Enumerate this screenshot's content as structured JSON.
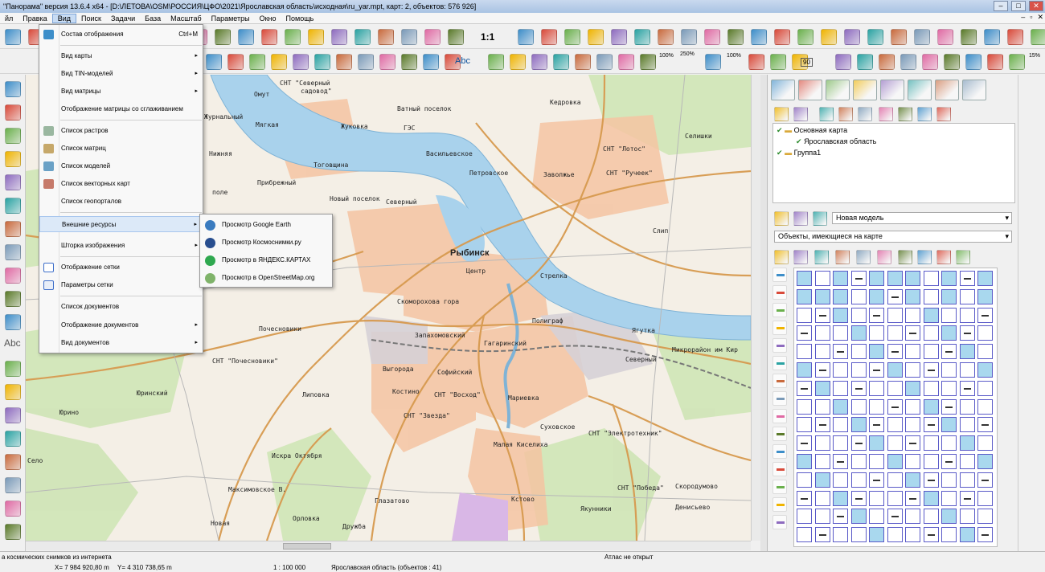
{
  "window": {
    "title": "\"Панорама\" версия 13.6.4 x64 - [D:\\ЛЕТОВА\\OSM\\РОССИЯ\\ЦФО\\2021\\Ярославская область\\исходная\\ru_yar.mpt, карт: 2, объектов: 576 926]",
    "btn_min": "–",
    "btn_max": "□",
    "btn_close": "✕",
    "mdi_min": "–",
    "mdi_restore": "▫",
    "mdi_close": "✕"
  },
  "menubar": [
    "йл",
    "Правка",
    "Вид",
    "Поиск",
    "Задачи",
    "База",
    "Масштаб",
    "Параметры",
    "Окно",
    "Помощь"
  ],
  "toolbar": {
    "scale_one_to_one": "1:1",
    "percent_a": "100%",
    "percent_b": "250%",
    "percent_c": "100%",
    "percent_d": "15%",
    "abc": "Abc",
    "scale_box_90": "90"
  },
  "left_toolbar": {
    "abc": "Abc"
  },
  "view_menu": {
    "items": [
      {
        "label": "Состав отображения",
        "shortcut": "Ctrl+M",
        "icon": "layers-icon"
      },
      {
        "label": "Вид карты",
        "arrow": "▸"
      },
      {
        "label": "Вид TIN-моделей",
        "arrow": "▸"
      },
      {
        "label": "Вид матрицы",
        "arrow": "▸"
      },
      {
        "label": "Отображение матрицы со сглаживанием"
      },
      {
        "label": "Список растров",
        "icon": "raster-list-icon"
      },
      {
        "label": "Список  матриц",
        "icon": "matrix-list-icon"
      },
      {
        "label": "Список  моделей",
        "icon": "model-list-icon"
      },
      {
        "label": "Список векторных карт",
        "icon": "vector-list-icon"
      },
      {
        "label": "Список геопорталов"
      },
      {
        "label": "Внешние ресурсы",
        "arrow": "▸"
      },
      {
        "label": "Шторка изображения",
        "arrow": "▸"
      },
      {
        "label": "Отображение сетки",
        "icon": "grid-icon"
      },
      {
        "label": "Параметры сетки",
        "icon": "grid-params-icon"
      },
      {
        "label": "Список документов"
      },
      {
        "label": "Отображение документов",
        "arrow": "▸"
      },
      {
        "label": "Вид  документов",
        "arrow": "▸"
      }
    ]
  },
  "external_submenu": [
    {
      "label": "Просмотр Google Earth"
    },
    {
      "label": "Просмотр Космоснимки.ру"
    },
    {
      "label": "Просмотр в ЯНДЕКС.КАРТАХ"
    },
    {
      "label": "Просмотр в OpenStreetMap.org"
    }
  ],
  "map_labels": {
    "rybinsk": "Рыбинск",
    "snt_severny": "СНТ \"Северный",
    "snt_severny2": "садовод\"",
    "omut": "Омут",
    "zhurnalny": "Журнальный",
    "myagkaya": "Мягкая",
    "nizhniya": "Нижняя",
    "zhukovka": "Жуковка",
    "ges": "ГЭС",
    "vasilevskoe": "Васильевское",
    "vatny": "Ватный поселок",
    "kedrovka": "Кедровка",
    "selishki": "Селишки",
    "snt_lotos": "СНТ \"Лотос\"",
    "snt_ruchek": "СНТ \"Ручеек\"",
    "petrovskoe": "Петровское",
    "zavolzhe": "Заволжье",
    "toginshina": "Тоговщина",
    "pribrezhny": "Прибрежный",
    "pole": "поле",
    "novy_poselok": "Новый поселок",
    "severny": "Северный",
    "slip": "Слип",
    "centr": "Центр",
    "strelka": "Стрелка",
    "skomorokhova": "Скоморохова гора",
    "pochesnoviki": "Почесновики",
    "zapakhomovsky": "Запахомовский",
    "poligraf": "Полиграф",
    "yagutka": "Ягутка",
    "gagarinsky": "Гагаринский",
    "mikrorayon": "Микрорайон им Кир",
    "snt_pochesnoviki": "СНТ \"Почесновики\"",
    "vygoroda": "Выгорода",
    "sofiysky": "Софийский",
    "severny_r": "Северный",
    "yurinsky": "Юринский",
    "lipovka": "Липовка",
    "kostino": "Костино",
    "snt_voskhod": "СНТ \"Восход\"",
    "marievka": "Мариевка",
    "yurino": "Юрино",
    "snt_zvezda": "СНТ \"Звезда\"",
    "sukhovskoe": "Суховское",
    "snt_elektrotekhnik": "СНТ \"Электротехник\"",
    "malaya_kiselikha": "Малая Киселиха",
    "iskra": "Искра  Октября",
    "snt_pobeda": "СНТ \"Победа\"",
    "skorodumovo": "Скородумово",
    "maksimovskoe": "Максимовское В.",
    "glazatovo": "Глазатово",
    "kstovo": "Кстово",
    "yakunniki": "Якунники",
    "denisevo": "Денисьево",
    "novaya": "Новая",
    "orlovka": "Орловка",
    "druzhba": "Дружба",
    "selo": "Село"
  },
  "right_panel": {
    "tree": [
      {
        "label": "Основная карта",
        "checked": true
      },
      {
        "label": "Ярославская область",
        "checked": true
      },
      {
        "label": "Группа1",
        "checked": true
      }
    ],
    "model_select": "Новая модель",
    "objects_select": "Объекты, имеющиеся на карте"
  },
  "status_bar": {
    "hint": "а космических снимков из интернета",
    "atlas": "Атлас не открыт",
    "x": "X= 7 984 920,80 m",
    "y": "Y= 4 310 738,65 m",
    "scale": "1 : 100 000",
    "region": "Ярославская область   (объектов : 41)"
  },
  "colors": {
    "water": "#a9d2ec",
    "road": "#e3a75c",
    "urban": "#f6c7a6",
    "forest": "#cde3b8",
    "menu_highlight": "#dce9f8"
  }
}
